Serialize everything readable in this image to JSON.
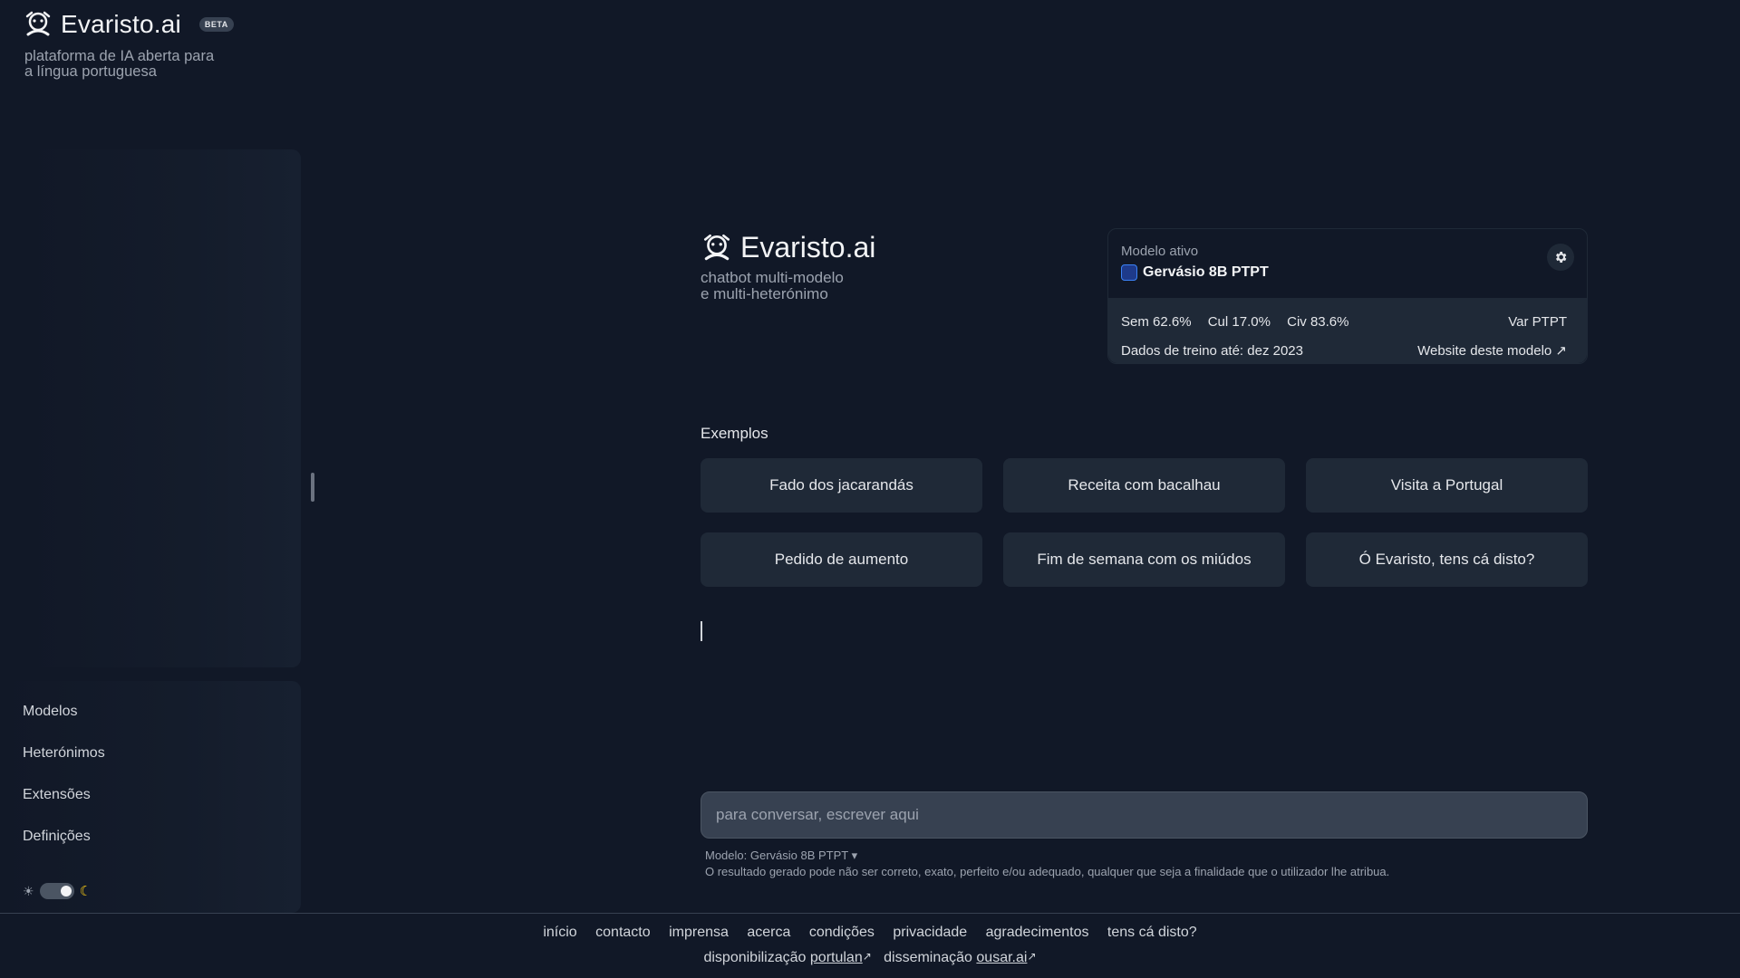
{
  "brand": {
    "name": "Evaristo.ai",
    "badge": "BETA",
    "tagline_line1": "plataforma de IA aberta para",
    "tagline_line2": "a língua portuguesa",
    "logo_icon": "evaristo-mascot-icon"
  },
  "sidebar": {
    "items": [
      {
        "label": "Modelos"
      },
      {
        "label": "Heterónimos"
      },
      {
        "label": "Extensões"
      },
      {
        "label": "Definições"
      }
    ],
    "theme": {
      "mode": "dark",
      "light_icon": "sun-icon",
      "dark_icon": "moon-icon"
    }
  },
  "hero": {
    "title": "Evaristo.ai",
    "subtitle_line1": "chatbot multi-modelo",
    "subtitle_line2": "e multi-heterónimo"
  },
  "model_card": {
    "label": "Modelo ativo",
    "name": "Gervásio 8B PTPT",
    "sem": "Sem 62.6%",
    "cul": "Cul 17.0%",
    "civ": "Civ 83.6%",
    "variant": "Var PTPT",
    "training": "Dados de treino até: dez 2023",
    "website_link": "Website deste modelo ↗"
  },
  "examples": {
    "label": "Exemplos",
    "items": [
      {
        "label": "Fado dos jacarandás"
      },
      {
        "label": "Receita com bacalhau"
      },
      {
        "label": "Visita a Portugal"
      },
      {
        "label": "Pedido de aumento"
      },
      {
        "label": "Fim de semana com os miúdos"
      },
      {
        "label": "Ó Evaristo, tens cá disto?"
      }
    ]
  },
  "chat": {
    "placeholder": "para conversar, escrever aqui",
    "model_selector": "Modelo: Gervásio 8B PTPT ▾",
    "disclaimer": "O resultado gerado pode não ser correto, exato, perfeito e/ou adequado, qualquer que seja a finalidade que o utilizador lhe atribua."
  },
  "footer": {
    "links": [
      {
        "label": "início"
      },
      {
        "label": "contacto"
      },
      {
        "label": "imprensa"
      },
      {
        "label": "acerca"
      },
      {
        "label": "condições"
      },
      {
        "label": "privacidade"
      },
      {
        "label": "agradecimentos"
      },
      {
        "label": "tens cá disto?"
      }
    ],
    "credit1_prefix": "disponibilização",
    "credit1_link": "portulan",
    "credit2_prefix": "disseminação",
    "credit2_link": "ousar.ai",
    "external_mark": "↗"
  },
  "colors": {
    "background": "#111827",
    "panel": "#1f2937",
    "input": "#374151",
    "accent_moon": "#facc15"
  }
}
